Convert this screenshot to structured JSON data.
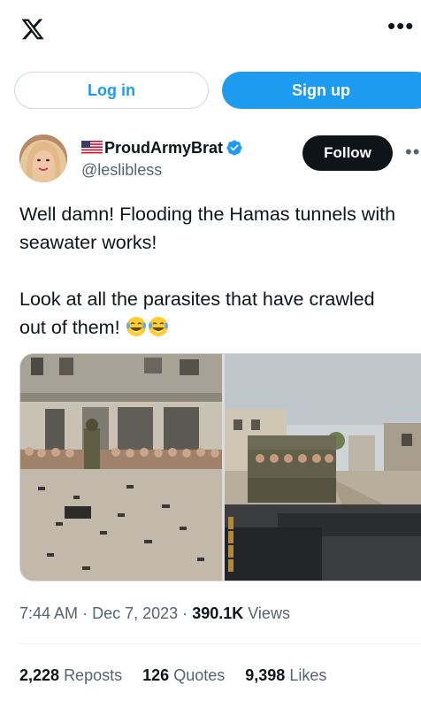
{
  "header": {
    "logo_icon": "x-logo-icon",
    "more_icon": "more-horizontal-icon"
  },
  "auth": {
    "login_label": "Log in",
    "signup_label": "Sign up"
  },
  "author": {
    "flag_icon": "us-flag-icon",
    "display_name": "ProudArmyBrat",
    "verified_icon": "verified-badge-icon",
    "handle": "@leslibless",
    "follow_label": "Follow"
  },
  "tweet": {
    "line1": "Well damn! Flooding the Hamas tunnels with",
    "line2": "seawater works!",
    "line3": "Look at all the parasites that have crawled",
    "line4": "out of them!",
    "emoji_icon": "face-with-tears-of-joy-icon"
  },
  "meta": {
    "time": "7:44 AM",
    "sep": "·",
    "date": "Dec 7, 2023",
    "views_count": "390.1K",
    "views_label": "Views"
  },
  "stats": {
    "reposts_count": "2,228",
    "reposts_label": "Reposts",
    "quotes_count": "126",
    "quotes_label": "Quotes",
    "likes_count": "9,398",
    "likes_label": "Likes"
  },
  "colors": {
    "accent": "#1d9bf0",
    "text": "#0f1419",
    "muted": "#536471",
    "border": "#cfd9de"
  }
}
